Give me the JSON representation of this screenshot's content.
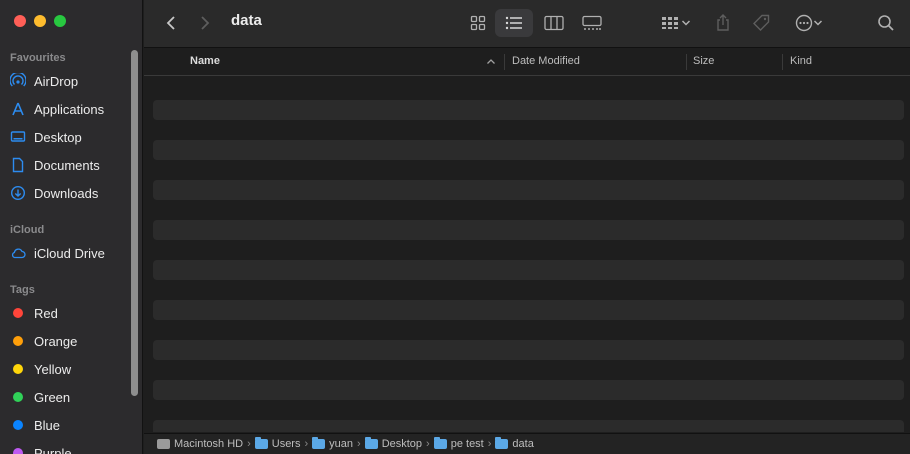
{
  "window": {
    "title": "data"
  },
  "sidebar": {
    "favourites_label": "Favourites",
    "favourites": [
      {
        "label": "AirDrop",
        "icon": "airdrop-icon"
      },
      {
        "label": "Applications",
        "icon": "applications-icon"
      },
      {
        "label": "Desktop",
        "icon": "desktop-icon"
      },
      {
        "label": "Documents",
        "icon": "document-icon"
      },
      {
        "label": "Downloads",
        "icon": "download-icon"
      }
    ],
    "icloud_label": "iCloud",
    "icloud": [
      {
        "label": "iCloud Drive",
        "icon": "cloud-icon"
      }
    ],
    "tags_label": "Tags",
    "tags": [
      {
        "label": "Red",
        "color": "#ff453a"
      },
      {
        "label": "Orange",
        "color": "#ff9f0a"
      },
      {
        "label": "Yellow",
        "color": "#ffd60a"
      },
      {
        "label": "Green",
        "color": "#30d158"
      },
      {
        "label": "Blue",
        "color": "#0a84ff"
      },
      {
        "label": "Purple",
        "color": "#bf5af2"
      }
    ]
  },
  "columns": {
    "name": "Name",
    "date_modified": "Date Modified",
    "size": "Size",
    "kind": "Kind"
  },
  "pathbar": {
    "crumbs": [
      "Macintosh HD",
      "Users",
      "yuan",
      "Desktop",
      "pe test",
      "data"
    ]
  },
  "colors": {
    "accent": "#0a84ff",
    "folder": "#5ba8e6"
  }
}
